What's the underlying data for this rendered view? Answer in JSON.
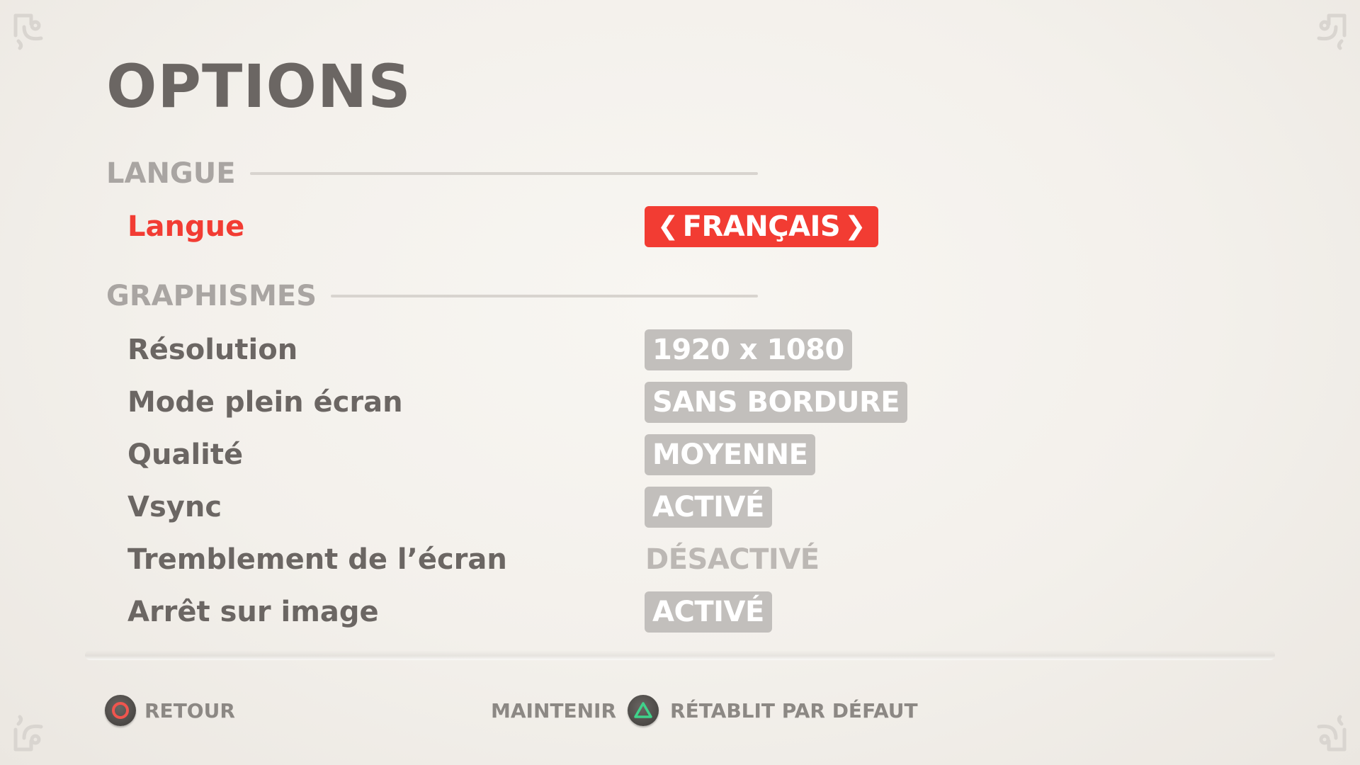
{
  "title": "OPTIONS",
  "sections": {
    "language": {
      "header": "LANGUE",
      "rows": [
        {
          "label": "Langue",
          "value": "FRANÇAIS"
        }
      ]
    },
    "graphics": {
      "header": "GRAPHISMES",
      "rows": [
        {
          "label": "Résolution",
          "value": "1920 x 1080"
        },
        {
          "label": "Mode plein écran",
          "value": "SANS BORDURE"
        },
        {
          "label": "Qualité",
          "value": "MOYENNE"
        },
        {
          "label": "Vsync",
          "value": "ACTIVÉ"
        },
        {
          "label": "Tremblement de l’écran",
          "value": "DÉSACTIVÉ"
        },
        {
          "label": "Arrêt sur image",
          "value": "ACTIVÉ"
        }
      ]
    }
  },
  "footer": {
    "back_button_icon": "circle-button-icon",
    "back_label": "RETOUR",
    "hold_label": "MAINTENIR",
    "reset_button_icon": "triangle-button-icon",
    "reset_label": "RÉTABLIT PAR DÉFAUT"
  },
  "colors": {
    "accent": "#f23c33",
    "text": "#6b6663",
    "value_bg": "#c2bfbc",
    "background": "#f3f0eb"
  }
}
